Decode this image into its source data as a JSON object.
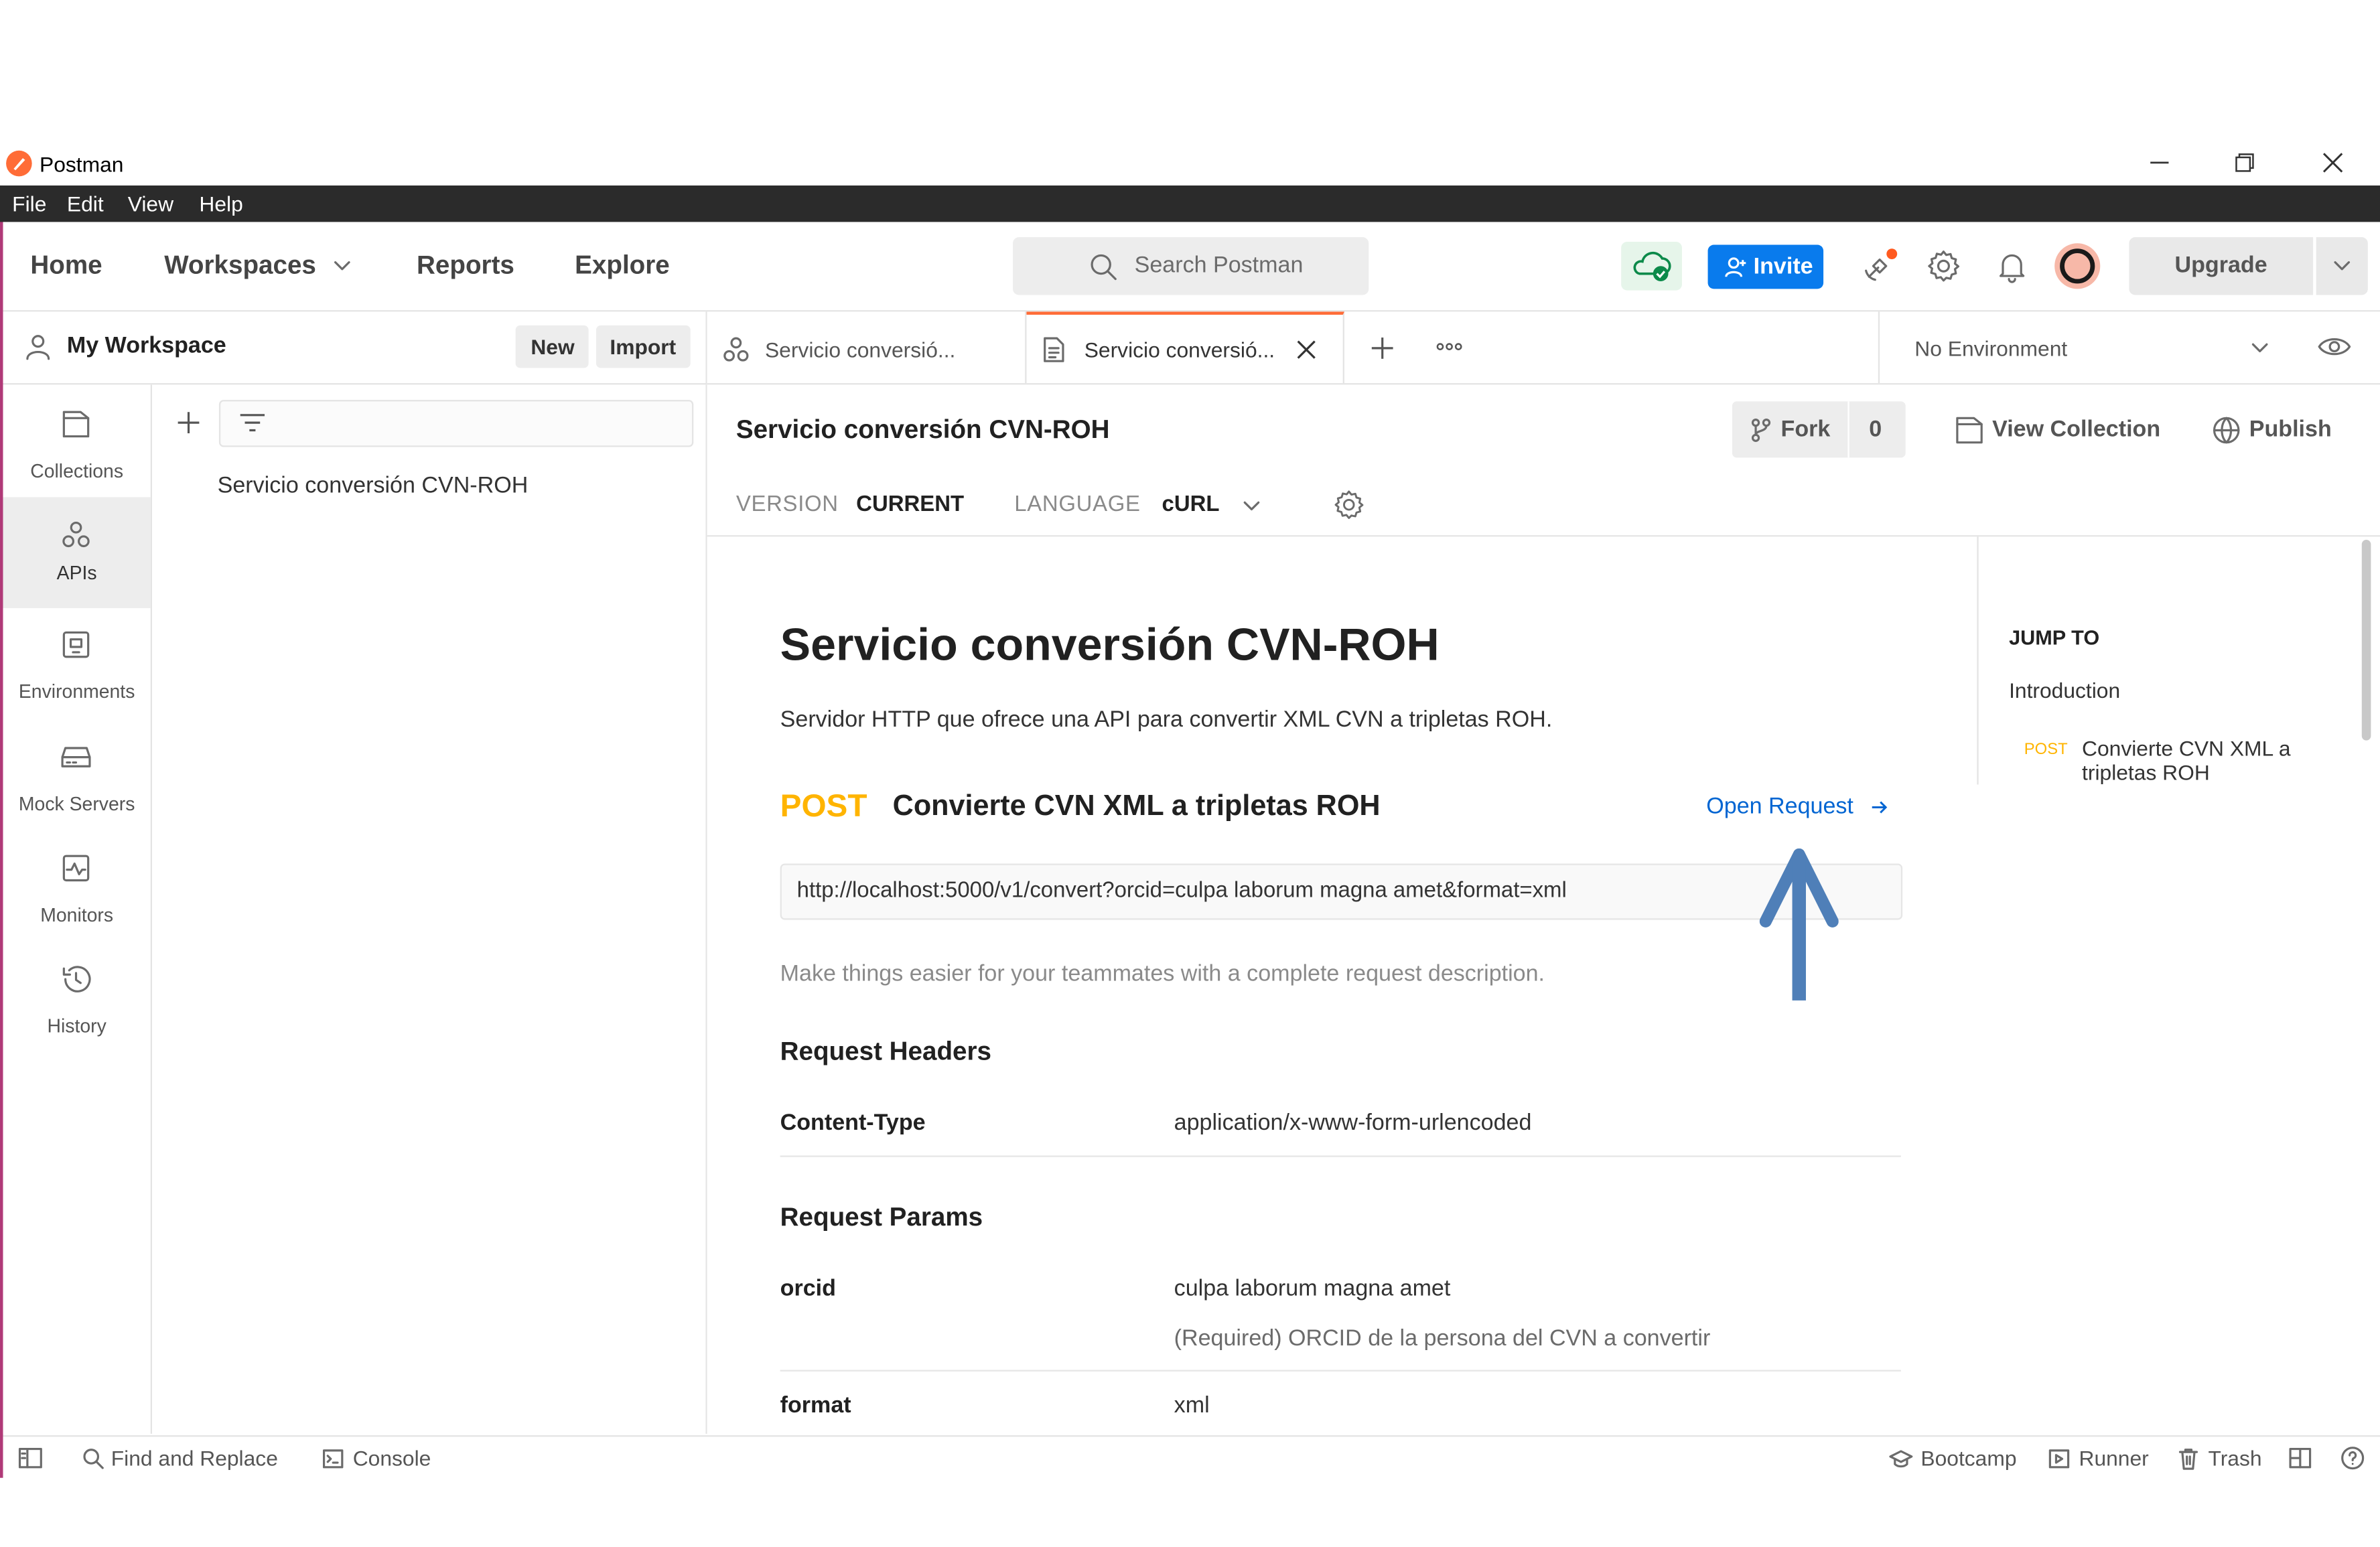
{
  "window": {
    "title": "Postman"
  },
  "menubar": [
    "File",
    "Edit",
    "View",
    "Help"
  ],
  "header": {
    "home": "Home",
    "workspaces": "Workspaces",
    "reports": "Reports",
    "explore": "Explore",
    "search_placeholder": "Search Postman",
    "invite": "Invite",
    "upgrade": "Upgrade"
  },
  "workspace": {
    "name": "My Workspace",
    "new_label": "New",
    "import_label": "Import"
  },
  "sidebar": {
    "items": [
      {
        "label": "Collections",
        "icon": "collections-icon"
      },
      {
        "label": "APIs",
        "icon": "apis-icon",
        "active": true
      },
      {
        "label": "Environments",
        "icon": "environments-icon"
      },
      {
        "label": "Mock Servers",
        "icon": "mock-servers-icon"
      },
      {
        "label": "Monitors",
        "icon": "monitors-icon"
      },
      {
        "label": "History",
        "icon": "history-icon"
      }
    ]
  },
  "api_list": {
    "items": [
      "Servicio conversión CVN-ROH"
    ]
  },
  "tabs": [
    {
      "label": "Servicio conversió..."
    },
    {
      "label": "Servicio conversió..."
    }
  ],
  "environment": {
    "selected": "No Environment"
  },
  "api_header": {
    "title": "Servicio conversión CVN-ROH",
    "fork_label": "Fork",
    "fork_count": "0",
    "view_collection": "View Collection",
    "publish": "Publish",
    "version_label": "VERSION",
    "version_value": "CURRENT",
    "language_label": "LANGUAGE",
    "language_value": "cURL"
  },
  "doc": {
    "title": "Servicio conversión CVN-ROH",
    "description": "Servidor HTTP que ofrece una API para convertir XML CVN a tripletas ROH.",
    "method": "POST",
    "request_name": "Convierte CVN XML a tripletas ROH",
    "open_request": "Open Request",
    "url": "http://localhost:5000/v1/convert?orcid=culpa laborum magna amet&format=xml",
    "description_hint": "Make things easier for your teammates with a complete request description.",
    "headers_title": "Request Headers",
    "headers": [
      {
        "key": "Content-Type",
        "value": "application/x-www-form-urlencoded"
      }
    ],
    "params_title": "Request Params",
    "params": [
      {
        "key": "orcid",
        "value": "culpa laborum magna amet",
        "description": "(Required) ORCID de la persona del CVN a convertir"
      },
      {
        "key": "format",
        "value": "xml"
      }
    ]
  },
  "jump_to": {
    "title": "JUMP TO",
    "intro": "Introduction",
    "method": "POST",
    "request": "Convierte CVN XML a tripletas ROH"
  },
  "footer": {
    "find_replace": "Find and Replace",
    "console": "Console",
    "bootcamp": "Bootcamp",
    "runner": "Runner",
    "trash": "Trash"
  },
  "colors": {
    "accent": "#ff6c37",
    "invite": "#097bed",
    "post": "#ffb400",
    "link": "#0265d2",
    "arrow": "#4f7fb8"
  }
}
